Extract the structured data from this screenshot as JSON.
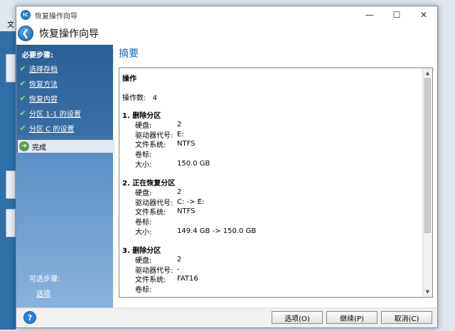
{
  "background": {
    "menu_text": "文"
  },
  "window": {
    "title": "恢复操作向导",
    "minimize_glyph": "—",
    "maximize_glyph": "☐",
    "close_glyph": "✕"
  },
  "header": {
    "title": "恢复操作向导",
    "back_icon": "arrow-left-icon"
  },
  "sidebar": {
    "required_heading": "必要步骤:",
    "steps": [
      {
        "label": "选择存档",
        "done": true
      },
      {
        "label": "恢复方法",
        "done": true
      },
      {
        "label": "恢复内容",
        "done": true
      },
      {
        "label": "分区 1-1 的设置",
        "done": true
      },
      {
        "label": "分区 C 的设置",
        "done": true
      }
    ],
    "current_step": "完成",
    "optional_heading": "可选步骤:",
    "optional_link": "选项"
  },
  "main": {
    "title": "摘要",
    "summary": {
      "heading": "操作",
      "ops_label": "操作数:",
      "ops_count": "4",
      "sections": [
        {
          "title": "1. 删除分区",
          "rows": [
            {
              "k": "硬盘:",
              "v": "2"
            },
            {
              "k": "驱动器代号:",
              "v": "E:"
            },
            {
              "k": "文件系统:",
              "v": "NTFS"
            },
            {
              "k": "卷标:",
              "v": ""
            },
            {
              "k": "大小:",
              "v": "150.0 GB"
            }
          ]
        },
        {
          "title": "2. 正在恢复分区",
          "rows": [
            {
              "k": "硬盘:",
              "v": "2"
            },
            {
              "k": "驱动器代号:",
              "v": "C: -> E:"
            },
            {
              "k": "文件系统:",
              "v": "NTFS"
            },
            {
              "k": "卷标:",
              "v": ""
            },
            {
              "k": "大小:",
              "v": "149.4 GB -> 150.0 GB"
            }
          ]
        },
        {
          "title": "3. 删除分区",
          "rows": [
            {
              "k": "硬盘:",
              "v": "2"
            },
            {
              "k": "驱动器代号:",
              "v": "-"
            },
            {
              "k": "文件系统:",
              "v": "FAT16"
            },
            {
              "k": "卷标:",
              "v": ""
            }
          ]
        }
      ]
    }
  },
  "buttons": {
    "help": "?",
    "options": "选项(O)",
    "next": "继续(P)",
    "cancel": "取消(C)"
  },
  "colors": {
    "accent": "#1a6bb5",
    "sidebar": "#3f74a8",
    "check": "#7fe06a"
  }
}
